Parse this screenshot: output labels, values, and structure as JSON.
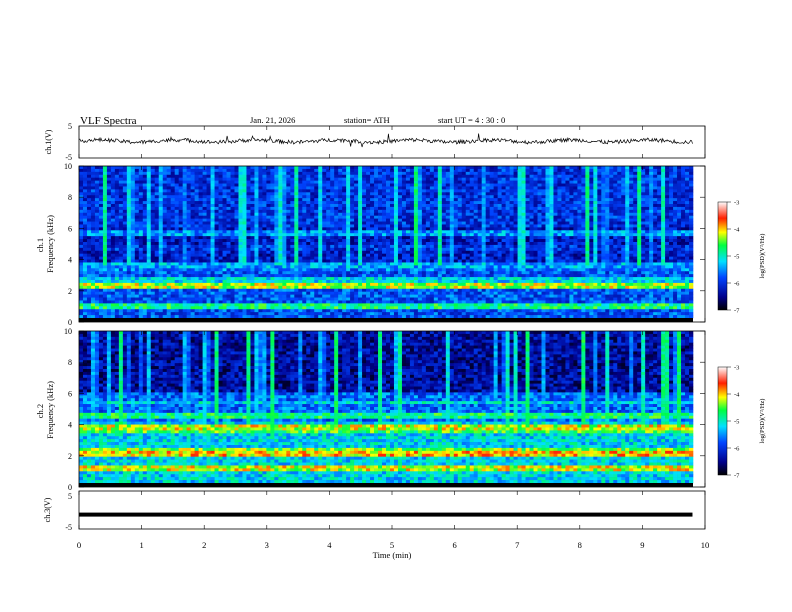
{
  "header": {
    "title": "VLF  Spectra",
    "date": "Jan. 21, 2026",
    "station": "station= ATH",
    "start": "start  UT  =   4  : 30 : 0"
  },
  "chart_data": [
    {
      "type": "line",
      "id": "ch1-waveform",
      "ylabel": "ch.1(V)",
      "ylim": [
        -5,
        5
      ],
      "yticks": [
        "5",
        "-5"
      ],
      "description_values": "noisy waveform centred slightly above 0 V, sporadic spikes",
      "x_range": [
        0,
        9.8
      ]
    },
    {
      "type": "heatmap",
      "id": "ch1-spectrogram",
      "ylabel": "ch.1\nFrequency  (kHz)",
      "ylabel_lines": [
        "ch.1",
        "Frequency  (kHz)"
      ],
      "ylim": [
        0,
        10
      ],
      "yticks": [
        "0",
        "2",
        "4",
        "6",
        "8",
        "10"
      ],
      "xlim": [
        0,
        10
      ],
      "colorbar": {
        "label": "log(PSD)(V²/Hz)",
        "range": [
          -7,
          -3
        ],
        "ticks": [
          "-3",
          "-4",
          "-5",
          "-6",
          "-7"
        ]
      },
      "bands_khz": [
        {
          "f": 2.1,
          "level": -4.3
        },
        {
          "f": 2.5,
          "level": -5.2
        },
        {
          "f": 3.2,
          "level": -5.6
        },
        {
          "f": 3.5,
          "level": -5.4
        },
        {
          "f": 4.6,
          "level": -6.0
        },
        {
          "f": 5.5,
          "level": -5.5
        },
        {
          "f": 0.8,
          "level": -4.8
        }
      ]
    },
    {
      "type": "heatmap",
      "id": "ch2-spectrogram",
      "ylabel_lines": [
        "ch.2",
        "Frequency  (kHz)"
      ],
      "ylim": [
        0,
        10
      ],
      "yticks": [
        "0",
        "2",
        "4",
        "6",
        "8",
        "10"
      ],
      "xlim": [
        0,
        10
      ],
      "colorbar": {
        "label": "log(PSD)(V²/Hz)",
        "range": [
          -7,
          -3
        ],
        "ticks": [
          "-3",
          "-4",
          "-5",
          "-6",
          "-7"
        ]
      },
      "bands_khz": [
        {
          "f": 1.0,
          "level": -4.2
        },
        {
          "f": 2.0,
          "level": -4.0
        },
        {
          "f": 2.2,
          "level": -4.4
        },
        {
          "f": 3.4,
          "level": -4.6
        },
        {
          "f": 3.6,
          "level": -4.2
        },
        {
          "f": 4.4,
          "level": -4.8
        },
        {
          "f": 5.3,
          "level": -5.2
        }
      ]
    },
    {
      "type": "line",
      "id": "ch3-waveform",
      "ylabel": "ch.3(V)",
      "ylim": [
        -5,
        5
      ],
      "yticks": [
        "5",
        "0",
        "-5"
      ],
      "constant_value": -1.2,
      "x_range": [
        0,
        9.8
      ]
    }
  ],
  "xaxis": {
    "label": "Time  (min)",
    "ticks": [
      "0",
      "1",
      "2",
      "3",
      "4",
      "5",
      "6",
      "7",
      "8",
      "9",
      "10"
    ],
    "xlim": [
      0,
      10
    ]
  }
}
